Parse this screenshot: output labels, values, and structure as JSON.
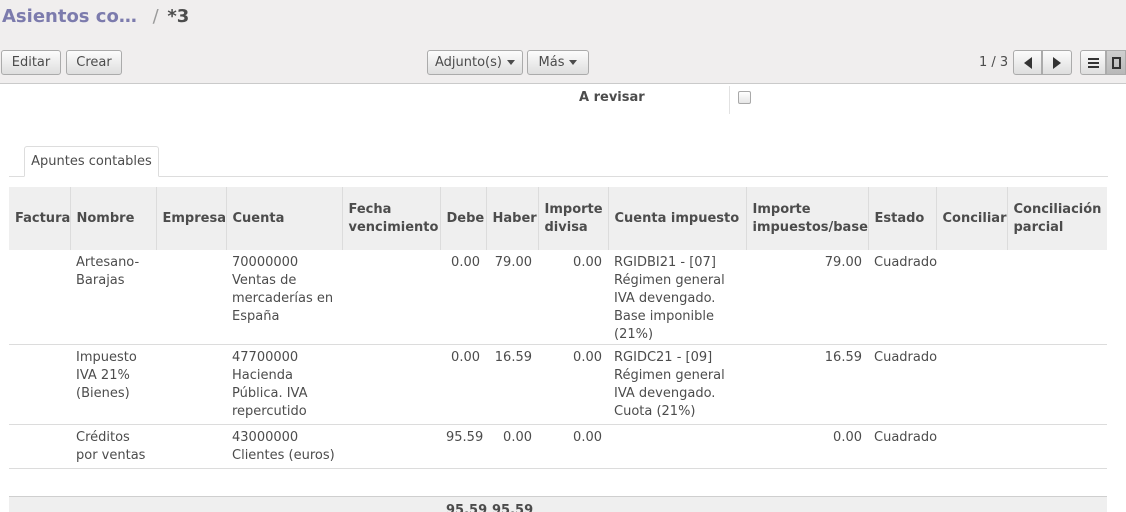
{
  "breadcrumb": {
    "parent": "Asientos co…",
    "separator": "/",
    "current": "*3"
  },
  "toolbar": {
    "edit_label": "Editar",
    "create_label": "Crear",
    "attachments_label": "Adjunto(s)",
    "more_label": "Más"
  },
  "pager": {
    "value": "1 / 3"
  },
  "form": {
    "to_review_label": "A revisar",
    "to_review_checked": false
  },
  "tabs": [
    {
      "label": "Apuntes contables"
    }
  ],
  "table": {
    "columns": [
      "Factura",
      "Nombre",
      "Empresa",
      "Cuenta",
      "Fecha vencimiento",
      "Debe",
      "Haber",
      "Importe divisa",
      "Cuenta impuesto",
      "Importe impuestos/base",
      "Estado",
      "Conciliar",
      "Conciliación parcial"
    ],
    "rows": [
      {
        "factura": "",
        "nombre": "Artesano-Barajas",
        "empresa": "",
        "cuenta": "70000000 Ventas de mercaderías en España",
        "fecha": "",
        "debe": "0.00",
        "haber": "79.00",
        "importe_divisa": "0.00",
        "cuenta_impuesto": "RGIDBI21 - [07] Régimen general IVA devengado. Base imponible (21%)",
        "importe_impuestos": "79.00",
        "estado": "Cuadrado",
        "conciliar": "",
        "conciliacion_parcial": ""
      },
      {
        "factura": "",
        "nombre": "Impuesto IVA 21% (Bienes)",
        "empresa": "",
        "cuenta": "47700000 Hacienda Pública. IVA repercutido",
        "fecha": "",
        "debe": "0.00",
        "haber": "16.59",
        "importe_divisa": "0.00",
        "cuenta_impuesto": "RGIDC21 - [09] Régimen general IVA devengado. Cuota (21%)",
        "importe_impuestos": "16.59",
        "estado": "Cuadrado",
        "conciliar": "",
        "conciliacion_parcial": ""
      },
      {
        "factura": "",
        "nombre": "Créditos por ventas",
        "empresa": "",
        "cuenta": "43000000 Clientes (euros)",
        "fecha": "",
        "debe": "95.59",
        "haber": "0.00",
        "importe_divisa": "0.00",
        "cuenta_impuesto": "",
        "importe_impuestos": "0.00",
        "estado": "Cuadrado",
        "conciliar": "",
        "conciliacion_parcial": ""
      }
    ],
    "totals": {
      "debe": "95.59",
      "haber": "95.59"
    }
  },
  "icons": {
    "pager_prev": "arrow-left-icon",
    "pager_next": "arrow-right-icon",
    "view_list": "list-view-icon",
    "view_form": "form-view-icon"
  }
}
